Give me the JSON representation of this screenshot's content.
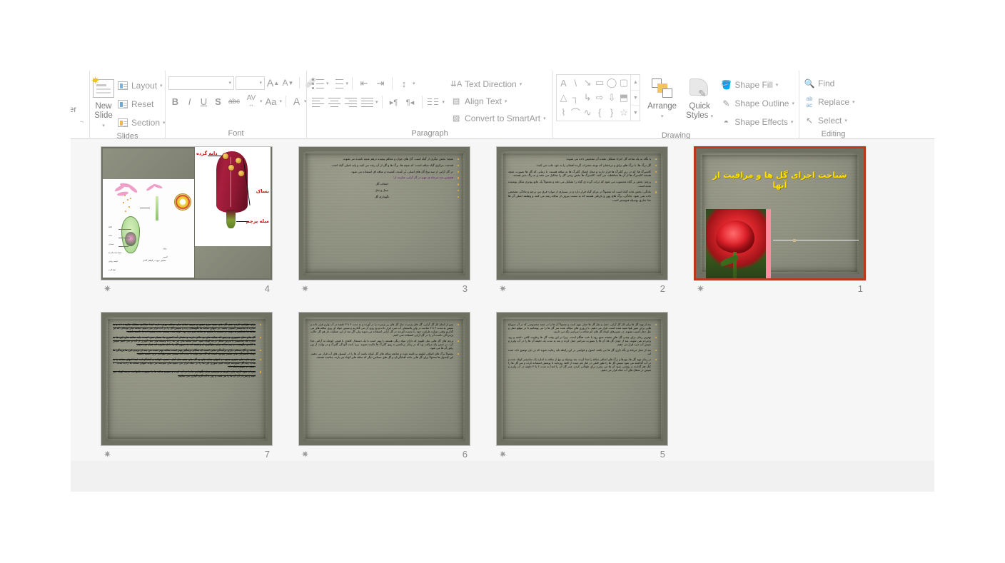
{
  "app": {
    "name": "PowerPoint",
    "view": "slide-sorter"
  },
  "ribbon": {
    "clipboard": {
      "stub_label": "er"
    },
    "slides": {
      "label": "Slides",
      "new_slide_label": "New\nSlide",
      "new_slide_line1": "New",
      "new_slide_line2": "Slide",
      "layout_label": "Layout",
      "reset_label": "Reset",
      "section_label": "Section"
    },
    "font": {
      "label": "Font",
      "font_name_value": "",
      "font_size_value": "",
      "grow_font_label": "A",
      "shrink_font_label": "A",
      "clear_formatting_label": "A",
      "bold_label": "B",
      "italic_label": "I",
      "underline_label": "U",
      "shadow_label": "S",
      "strikethrough_label": "abc",
      "char_spacing_label": "AV",
      "change_case_label": "Aa",
      "font_color_label": "A"
    },
    "paragraph": {
      "label": "Paragraph",
      "text_direction_label": "Text Direction",
      "align_text_label": "Align Text",
      "convert_smartart_label": "Convert to SmartArt"
    },
    "drawing": {
      "label": "Drawing",
      "arrange_label": "Arrange",
      "quick_styles_line1": "Quick",
      "quick_styles_line2": "Styles",
      "shape_fill_label": "Shape Fill",
      "shape_outline_label": "Shape Outline",
      "shape_effects_label": "Shape Effects",
      "shapes": [
        "text-box",
        "line",
        "arrow-line",
        "rectangle",
        "oval",
        "rounded-rect",
        "triangle",
        "elbow-connector",
        "elbow-arrow",
        "right-arrow",
        "down-arrow",
        "folded-corner",
        "scribble",
        "arc",
        "curve",
        "left-brace",
        "right-brace",
        "star"
      ],
      "shape_glyphs": [
        "A",
        "\\",
        "↘",
        "▭",
        "◯",
        "▢",
        "△",
        "┐",
        "↳",
        "⇨",
        "⇩",
        "⬒",
        "⌇",
        "⌒",
        "∿",
        "{",
        "}",
        "☆"
      ]
    },
    "editing": {
      "label": "Editing",
      "find_label": "Find",
      "replace_label": "Replace",
      "select_label": "Select"
    }
  },
  "slides": [
    {
      "number": "4",
      "kind": "diagram",
      "has_animation": true,
      "selected": false,
      "labels": {
        "pollen": "دانه گرده",
        "anther": "بساک",
        "filament": "میله پرچم",
        "caption": "تشکیل میوه در گیاهان گلدار",
        "small_labels": [
          "کلاله",
          "خامه",
          "تخمدان",
          "تخمک (دانه گرده)",
          "کیسه رویانی",
          "لوله گرده",
          "رویان",
          "آلبومن",
          "پی",
          "گیاه اغاز"
        ]
      }
    },
    {
      "number": "3",
      "kind": "text",
      "has_animation": true,
      "selected": false,
      "bullets": [
        {
          "text": "غنچه؛ بخش دیگری از گیاه است. گل های جوان و محکم پیچیده درهم غنچه نامیده می شوند.",
          "style": "normal"
        },
        {
          "text": "قسمت مرکزی گیاه ساقه است؛ که غنچه ها، برگ ها و گل از آن رشد می کنند و پایه اصلی گیاه است.",
          "style": "normal"
        },
        {
          "text": "در گل آرایی از سه نوع گل های اصلی، پُر کننده، کشیده و ساقه ای استفاده می شود.",
          "style": "normal"
        },
        {
          "text": "همچنین سه مرحله ی مهم در گل آرایی عبارتند از:",
          "style": "highlight"
        },
        {
          "text": "انتخاب گل",
          "style": "short"
        },
        {
          "text": "حمل و نقل",
          "style": "short"
        },
        {
          "text": "نگهداری گل",
          "style": "short"
        }
      ]
    },
    {
      "number": "2",
      "kind": "text",
      "has_animation": true,
      "selected": false,
      "bullets": [
        {
          "text": "با نگاه به یک شاخه گل اجزاء تشکیل دهنده آن تشخیص داده می شوند:",
          "style": "normal"
        },
        {
          "text": "گل برگ ها: با برگ های براق و درخشان که توجه حشرات گرده افشان را به خود جلب می کنند؛",
          "style": "normal"
        },
        {
          "text": "کاسبرگ ها: که در زیر گلبرگ ها قرار دارند و محل اتصال گلبرگ ها به ساقه هستند. تا زمانی که گل ها بصورت غنچه هستند کاسبرگ ها از آن ها محافظت می کنند. کاسبرگ ها بخش زینتی گل را تشکیل می دهند و به رنگ سبز هستند.",
          "style": "normal"
        },
        {
          "text": "پرچم: بخش نر گیاه محسوب می شود که ذرات گرده ی گیاه را تشکیل می دهد و معمولاً یک مایع پودری شکل پوشیده شده است.",
          "style": "normal"
        },
        {
          "text": "مادگی: بخش ماده گیاه است که معمولاً در مرکز گیاه قرار دارد و در بسیاری از موارد فرق بین پرچم و مادگی تشخیص داده نمی شود. مادگی، برگ های پهن و باریکی هستند که به سمت بیرون از ساقه رشد می کنند و وظیفه اصلی آن ها غذا سازی بوسیله فتوسنتز است.",
          "style": "normal"
        }
      ]
    },
    {
      "number": "1",
      "kind": "title",
      "has_animation": true,
      "selected": true,
      "title": "شناخت اجزای گل ها و مراقبت از آنها"
    },
    {
      "number": "7",
      "kind": "text-edited",
      "has_animation": true,
      "selected": false,
      "bullets": [
        {
          "text": "برای طولانی کردن عمر گل های مقید مرغ عشق و مریم، ساقه های محکم چوبی دارند ابتدا شکافی بشکل علاوه (+)، و به اندازه ۵ سانتیمتر آسیبی باشد. در انتهای ساقه ها نگهشکل زده و سپس گل را در آب قرار می دهیم. ساقه های توخالی که لی ساقه ها محکمتر و چوبی تر هستند با مکش به ساقه فرو می رود. لوله شده بیشتر جذب بیشتر آب را داشته باشند.",
          "style": "strike"
        },
        {
          "text": "گل های مثل شیپوری و زنبق که ساقه های تو خالی دارند و مقدار آب کمتری ها بسیار نمی است، باید ساقه های این ها به اندازه یک سانتیمتر با عرض شکل درجه کوتاه شود. ابتدا ساقه های این ها را با وسیله های مثل آویزی از آب بر می کنیم سپس با کاغذی نگهشت در زیر ساقه برای جلوگیری از وظیفه آب به خروج گل را داخل ظرف آب قرار می دهیم.",
          "style": "strike"
        },
        {
          "text": "ساقه ی گل محکم دارای برآمدگی هایی است که هنگام برشگیر بهتر است ساقه بهتر شده می بعد از بریدن این ها بریدگی ها کوتاه کاسبرگی های بیشتر موجود است که گل می تواند با جذب آب بیشتر عمر طولانی تری داشته باشند.",
          "style": "strike"
        },
        {
          "text": "برای غازه های شیری مجود در انتهای ساقه های ی گل های مقید مثل آهار، ختمی، کوکب و آفتابگردان، ابتدا انتهای ساقه را به مدت چند گل بسوخته کوتاه کنیم سوزی این ها را در خنک قرار می دهیم های سوخته می تواند انتهای ساقه ها را به مدت ۲۰ دقیقه در جوش قرار داد.",
          "style": "strike"
        },
        {
          "text": "پس از تمیز کاری های داوری و همچنین محل نگهداری ها را در آب کرده و سپس ساقه ها را بصورت یکنواخت درجه کوتاه می کنیم و پس از آن آن ها را هر شب و روز با آب گرم آبیاری می نماییم.",
          "style": "strike"
        }
      ]
    },
    {
      "number": "6",
      "kind": "text",
      "has_animation": true,
      "selected": false,
      "bullets": [
        {
          "text": "پس از اتمام کار گل آرایی، گل های پژمرده مثل گل های رز پژمرده را در آورده و به مدت ۲ تا ۳ دقیقه در آب ولرم قرار داده و سپس به مدت ۳ تا ۳ ساعت در ولن پلاستیکی آب سرد قرار داده و یخ روی آن می گذاریم و سپس حوله ای روی ساقه های می گذاریم وقتی دوباره طراوت خود را بدست آوردند در گل آرایی استفاده می شوند ولی اگر بعد از این عملیات باز هم گل حالت پژمردگی داشت آن را در گل آرایی استفاده نمی کنیم.",
          "style": "dense"
        },
        {
          "text": "پرچم های گل هایی مثل لیلیوم که دارای مواد رنگی هستند را بهتر است با یک دستمال کاغذی با قیچی کوچک به آرامی جدا کرد. در ضمن باید مراقب بود که در زمان برداشتن به روی گلبرگ ها مالیده نشوند. زیرا باعث آلودگی گلبرگ و در نهایت از بین رفتن آن ها می شود.",
          "style": "dense"
        },
        {
          "text": "معمولاً برگ های اضافی لیلیوم برداشته شده و چنانچه ساقه های گل کوتاه باشند آن ها را در کپسول های آب قرار می دهیم. این کپسول ها معمولاً برای گل هایی مانند آفتابگردان و گل های حساس دیگر که ساقه های کوتاه تیز دارند، مناسب هستند.",
          "style": "dense"
        }
      ]
    },
    {
      "number": "5",
      "kind": "text",
      "has_animation": true,
      "selected": false,
      "bullets": [
        {
          "text": "بعد از تهیه گل ها برای کار گل آرایی، حمل و نقل گل ها خیلی مهم است و معمولاً آن ها را در جعبه مخصوصی که در آن سوراخ هایی برای عبور هوا تعبیه شده است، قرار می دهیم. با ژروری های مچاله شده سر گل ها را می پوشانیم تا در موقع حمل و نقل دچار آسیب نشوند. در مسیرهای کوتاه گل های کم شاخه را سراسر تگه می داریم.",
          "style": "dense"
        },
        {
          "text": "بهترین زمان برای چیدن گل های بنفشه صبح زود یا شب هنگام است. زیرا در این وقت گل ها رطوبت کافی داشته و زود پژمرده نمی شوند. بعد از چیدن گل ها، آن ها را بصورت سراسر حمل کرده و بعد به مدت یک دقیقه آن ها را در آب ولرم و سپس آب سرد قرار می دهیم.",
          "style": "dense"
        },
        {
          "text": "بعد از حمل مرحله ی نگه داری گل ها می باشد. اصول و قوانینی در این رابطه باید رعایت شوند که در ذیل توضیح داده شده اند.",
          "style": "dense"
        },
        {
          "text": "در زمان تهیه گل ها، تیغ ها و برگ های اضافی ساقه را جدا کرده، بعد بوسیله ی تیغ از ساقه به اندازه یک سانتیمتر کوتاه شده و در آب گذاشته می شود سپس گل ها را طور افقی در کنار هم چیده از کاغذ روزنامه با پوشش استفاده کرده و سر گل ها را کنار هم گذارده و روشنی شود آن ها می پنجره برای طولانی کردن عمر گل آن را ابتدا به مدت ۲ یا ۳ دقیقه در آب ولرم و سپس در سطل های آب خنک قرار می دهیم.",
          "style": "dense"
        }
      ]
    }
  ]
}
